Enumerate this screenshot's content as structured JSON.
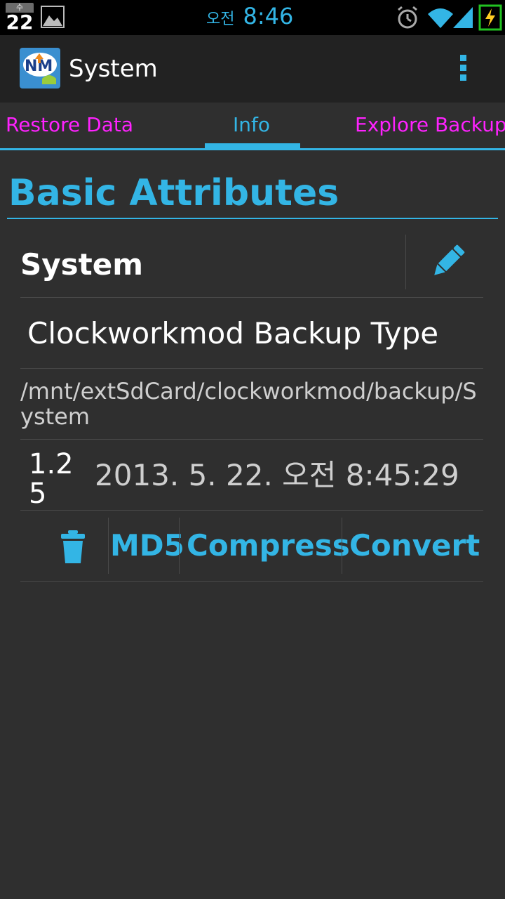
{
  "status_bar": {
    "calendar_weekday": "수",
    "calendar_day": "22",
    "ampm": "오전",
    "time": "8:46",
    "icons": [
      "calendar-icon",
      "gallery-icon",
      "alarm-icon",
      "wifi-icon",
      "signal-icon",
      "battery-charging-icon"
    ]
  },
  "action_bar": {
    "title": "System",
    "app_icon": "nm-app-icon",
    "overflow_icon": "overflow-menu-icon"
  },
  "tabs": [
    {
      "label": "Restore Data",
      "selected": false,
      "color": "#ff22ff"
    },
    {
      "label": "Info",
      "selected": true,
      "color": "#33b5e5"
    },
    {
      "label": "Explore Backup",
      "selected": false,
      "color": "#ff22ff"
    }
  ],
  "section": {
    "title": "Basic Attributes"
  },
  "backup": {
    "name": "System",
    "type": "Clockworkmod Backup Type",
    "path": "/mnt/extSdCard/clockworkmod/backup/System",
    "version": "1.25",
    "date": "2013. 5. 22. 오전 8:45:29"
  },
  "actions": {
    "md5": "MD5",
    "compress": "Compress",
    "convert": "Convert"
  },
  "colors": {
    "accent": "#33b5e5",
    "inactive_tab": "#ff22ff",
    "background": "#2f2f2f"
  }
}
